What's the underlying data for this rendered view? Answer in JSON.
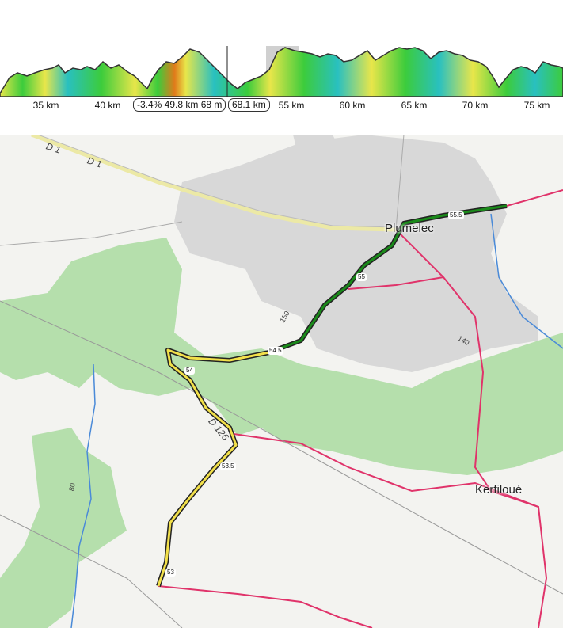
{
  "profile": {
    "km_ticks": [
      "35 km",
      "40 km",
      "55 km",
      "60 km",
      "65 km",
      "70 km",
      "75 km"
    ],
    "cursor_readout": "-3.4% 49.8 km 68 m",
    "cursor_distance": "68.1 km"
  },
  "map": {
    "towns": [
      "Plumelec",
      "Kerfiloué"
    ],
    "roads": [
      "D 1",
      "D 1",
      "D 126"
    ],
    "contour_labels": [
      "150",
      "140",
      "80"
    ],
    "route_km_markers": [
      "55.5",
      "55",
      "54.5",
      "54",
      "53.5",
      "53"
    ]
  },
  "colors": {
    "route_green": "#1a8a1a",
    "route_yellow": "#f2e04a",
    "forest": "#a9dba0",
    "urban": "#d8d8d8",
    "road_red": "#e0336a"
  }
}
